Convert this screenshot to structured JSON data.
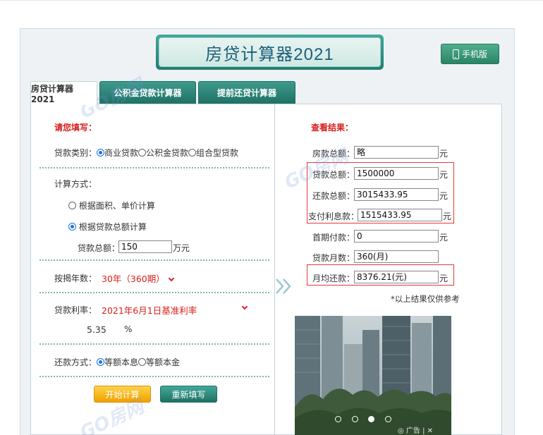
{
  "header": {
    "title": "房贷计算器2021",
    "mobile_label": "手机版"
  },
  "tabs": [
    "房贷计算器2021",
    "公积金贷款计算器",
    "提前还贷计算器"
  ],
  "form": {
    "heading": "请您填写：",
    "loan_type_label": "贷款类别：",
    "loan_types": [
      "商业贷款",
      "公积金贷款",
      "组合型贷款"
    ],
    "calc_method_label": "计算方式：",
    "calc_methods": [
      "根据面积、单价计算",
      "根据贷款总额计算"
    ],
    "loan_amount_label": "贷款总额：",
    "loan_amount_value": "150",
    "loan_amount_unit": "万元",
    "years_label": "按揭年数：",
    "years_value": "30年（360期）",
    "rate_label": "贷款利率：",
    "rate_value": "2021年6月1日基准利率",
    "rate_number": "5.35",
    "rate_unit": "%",
    "repay_label": "还款方式：",
    "repay_methods": [
      "等额本息",
      "等额本金"
    ],
    "start_button": "开始计算",
    "reset_button": "重新填写"
  },
  "result": {
    "heading": "查看结果：",
    "house_total_label": "房款总额：",
    "house_total_value": "略",
    "loan_total_label": "贷款总额：",
    "loan_total_value": "1500000",
    "repay_total_label": "还款总额：",
    "repay_total_value": "3015433.95",
    "interest_label": "支付利息款：",
    "interest_value": "1515433.95",
    "down_payment_label": "首期付款：",
    "down_payment_value": "0",
    "months_label": "贷款月数：",
    "months_value": "360(月)",
    "monthly_label": "月均还款：",
    "monthly_value": "8376.21(元)",
    "unit": "元",
    "note": "*以上结果仅供参考",
    "ad_label": "广告"
  },
  "watermark": "GO房网"
}
